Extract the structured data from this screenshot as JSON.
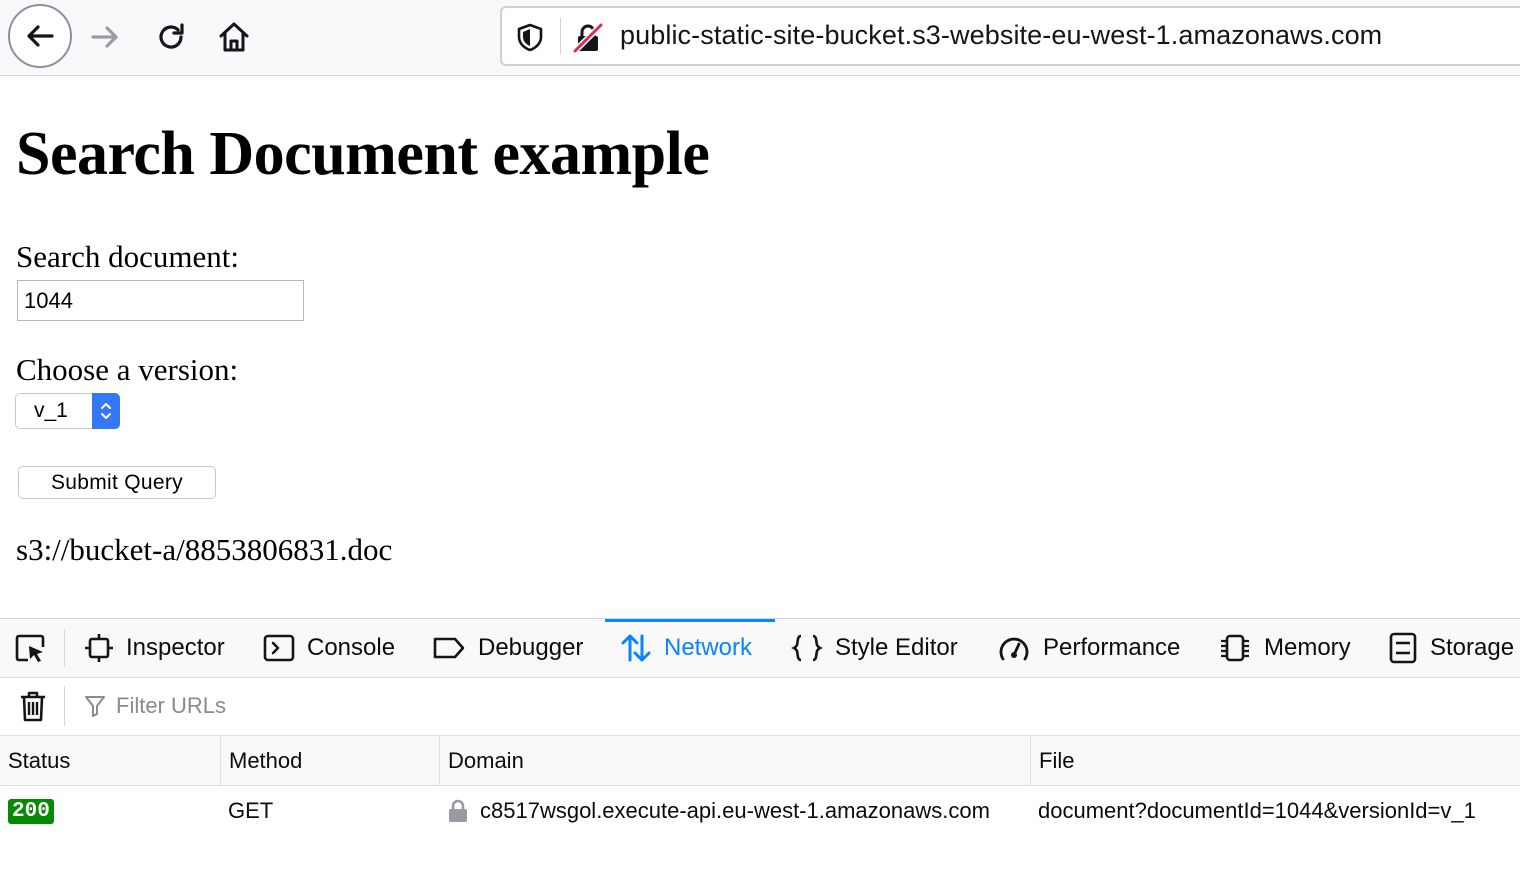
{
  "browser": {
    "url": "public-static-site-bucket.s3-website-eu-west-1.amazonaws.com",
    "icons": [
      "back-arrow-icon",
      "forward-arrow-icon",
      "reload-icon",
      "home-icon",
      "shield-icon",
      "insecure-lock-icon"
    ]
  },
  "page": {
    "title": "Search Document example",
    "search_label": "Search document:",
    "search_value": "1044",
    "version_label": "Choose a version:",
    "version_selected": "v_1",
    "submit_label": "Submit Query",
    "result": "s3://bucket-a/8853806831.doc"
  },
  "devtools": {
    "tabs": [
      {
        "label": "Inspector",
        "icon": "inspector-icon"
      },
      {
        "label": "Console",
        "icon": "console-icon"
      },
      {
        "label": "Debugger",
        "icon": "debugger-icon"
      },
      {
        "label": "Network",
        "icon": "network-icon",
        "active": true
      },
      {
        "label": "Style Editor",
        "icon": "style-editor-icon"
      },
      {
        "label": "Performance",
        "icon": "performance-icon"
      },
      {
        "label": "Memory",
        "icon": "memory-icon"
      },
      {
        "label": "Storage",
        "icon": "storage-icon"
      }
    ],
    "filter_placeholder": "Filter URLs",
    "columns": [
      "Status",
      "Method",
      "Domain",
      "File"
    ],
    "rows": [
      {
        "status": "200",
        "method": "GET",
        "domain": "c8517wsgol.execute-api.eu-west-1.amazonaws.com",
        "file": "document?documentId=1044&versionId=v_1"
      }
    ],
    "colors": {
      "active_tab": "#0a84ff",
      "status_ok": "#058b00"
    }
  }
}
